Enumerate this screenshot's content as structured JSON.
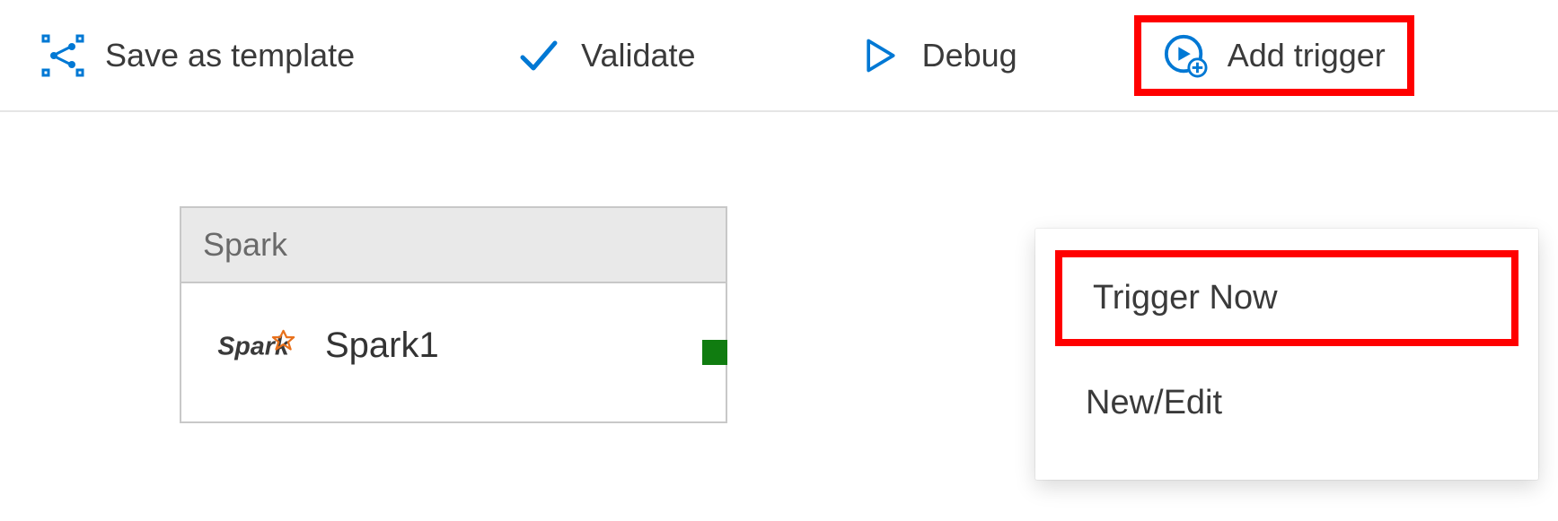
{
  "toolbar": {
    "save_template_label": "Save as template",
    "validate_label": "Validate",
    "debug_label": "Debug",
    "add_trigger_label": "Add trigger"
  },
  "activity": {
    "type_label": "Spark",
    "name": "Spark1"
  },
  "trigger_menu": {
    "items": [
      {
        "label": "Trigger Now"
      },
      {
        "label": "New/Edit"
      }
    ]
  },
  "colors": {
    "accent_blue": "#0078d4",
    "highlight_red": "#ff0000",
    "success_green": "#107c10",
    "spark_orange": "#e8711c"
  }
}
